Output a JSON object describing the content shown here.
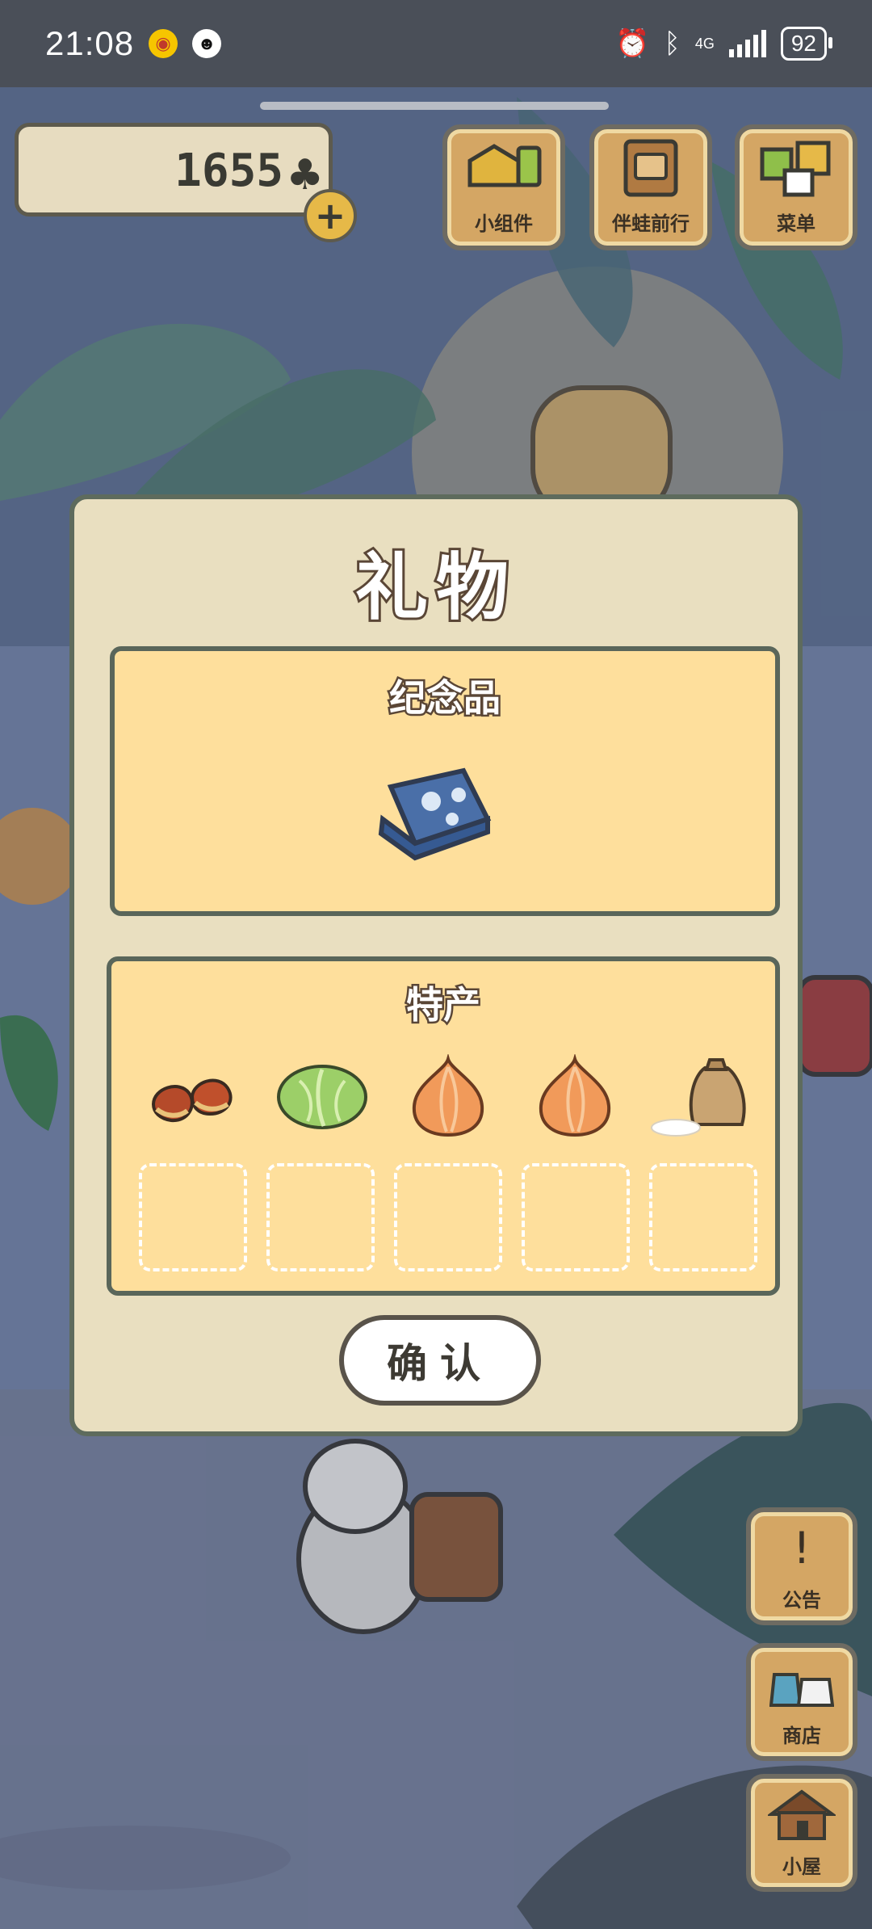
{
  "status_bar": {
    "time": "21:08",
    "network": "4G",
    "battery": "92",
    "icons": [
      "weibo-icon",
      "qq-icon",
      "alarm-icon",
      "bluetooth-icon",
      "signal-icon",
      "battery-icon"
    ]
  },
  "counter": {
    "value": "1655",
    "icon": "clover-icon"
  },
  "top_buttons": [
    {
      "label": "小组件",
      "icon": "widget-icon"
    },
    {
      "label": "伴蛙前行",
      "icon": "album-icon"
    },
    {
      "label": "菜单",
      "icon": "menu-icon"
    }
  ],
  "side_buttons": [
    {
      "label": "公告",
      "icon": "exclamation-icon"
    },
    {
      "label": "商店",
      "icon": "shop-bags-icon"
    },
    {
      "label": "小屋",
      "icon": "house-icon"
    }
  ],
  "dialog": {
    "title": "礼物",
    "souvenir_title": "纪念品",
    "souvenir_item": "blue-scarf-icon",
    "specialty_title": "特产",
    "specialty_items": [
      "chestnut-icon",
      "cabbage-icon",
      "onion-icon",
      "onion-icon",
      "rice-bag-icon"
    ],
    "empty_slots": 5,
    "confirm_label": "确认"
  },
  "colors": {
    "panel": "#e9dfc0",
    "section": "#fedf9c",
    "wood": "#d4a664",
    "status_bar": "#4a4f58"
  }
}
